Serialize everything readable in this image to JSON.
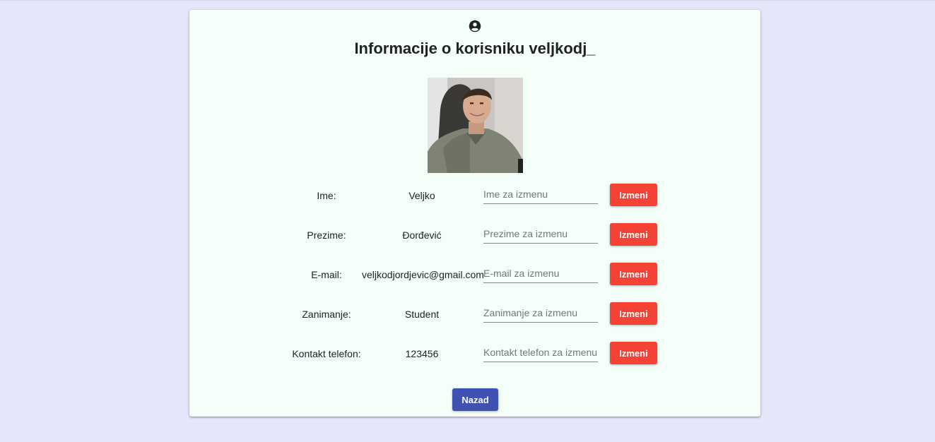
{
  "page": {
    "title": "Informacije o korisniku veljkodj_",
    "header_icon": "account-circle-icon",
    "avatar_alt": "profile-photo"
  },
  "fields": [
    {
      "label": "Ime:",
      "value": "Veljko",
      "placeholder": "Ime za izmenu",
      "button": "Izmeni"
    },
    {
      "label": "Prezime:",
      "value": "Đorđević",
      "placeholder": "Prezime za izmenu",
      "button": "Izmeni"
    },
    {
      "label": "E-mail:",
      "value": "veljkodjordjevic@gmail.com",
      "placeholder": "E-mail za izmenu",
      "button": "Izmeni"
    },
    {
      "label": "Zanimanje:",
      "value": "Student",
      "placeholder": "Zanimanje za izmenu",
      "button": "Izmeni"
    },
    {
      "label": "Kontakt telefon:",
      "value": "123456",
      "placeholder": "Kontakt telefon za izmenu",
      "button": "Izmeni"
    }
  ],
  "footer": {
    "back_label": "Nazad"
  },
  "colors": {
    "background": "#e6e6fa",
    "card": "#f3fff8",
    "edit_button": "#f44336",
    "back_button": "#3f51b5"
  }
}
